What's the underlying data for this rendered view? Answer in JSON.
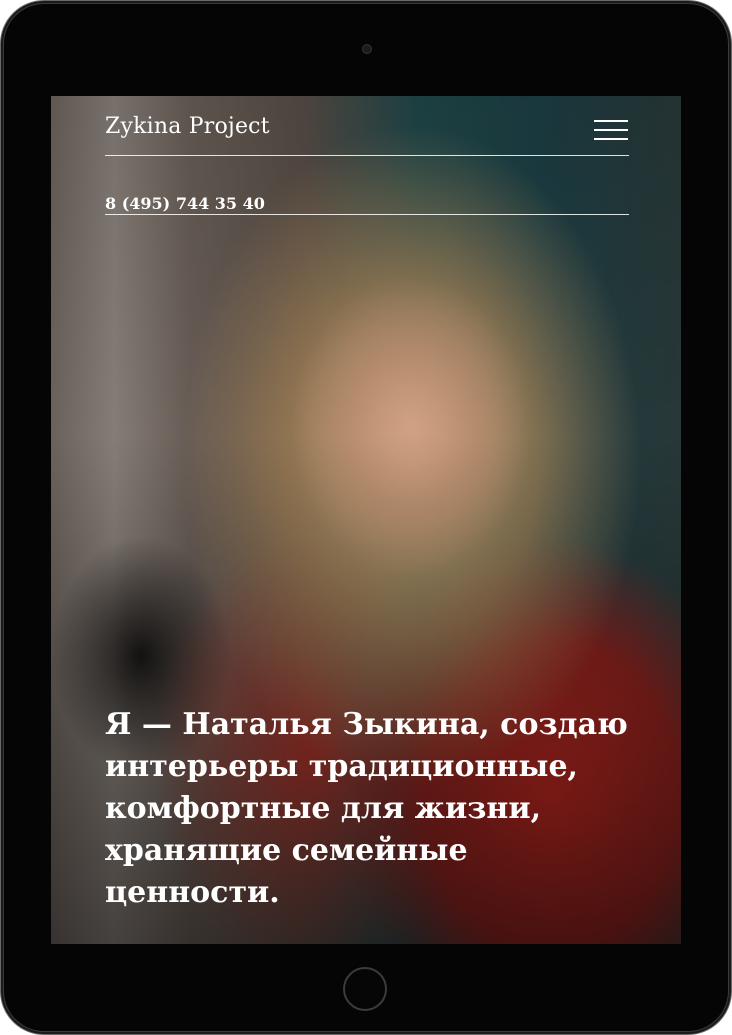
{
  "site": {
    "brand": "Zykina Project",
    "phone": "8 (495) 744 35 40",
    "menu_icon": "hamburger-menu-icon"
  },
  "hero": {
    "lines": [
      "Я — Наталья Зыкина, создаю",
      "интерьеры традиционные,",
      "комфортные для жизни,",
      "хранящие семейные",
      "ценности."
    ]
  },
  "colors": {
    "text": "#ffffff",
    "device_frame": "#050505",
    "dress_red": "#c4261e"
  }
}
